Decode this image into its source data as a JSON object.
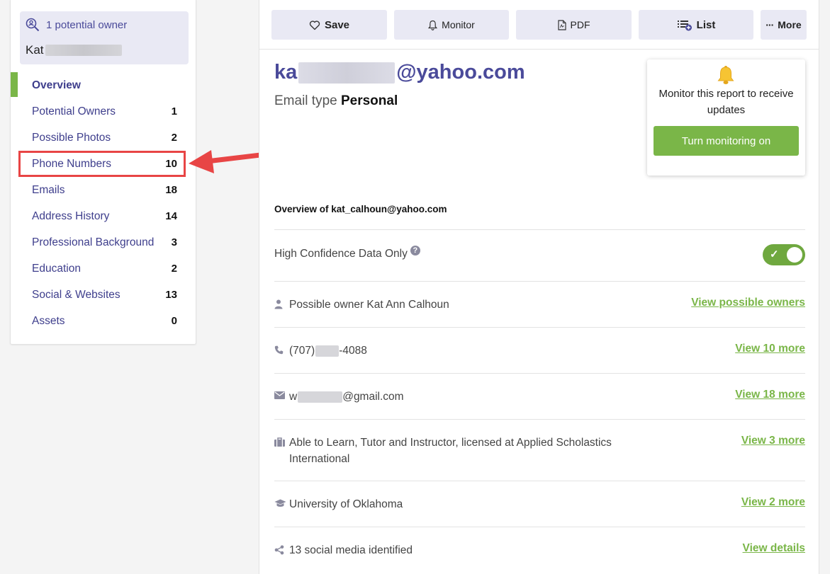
{
  "sidebar": {
    "owner_count": "1 potential owner",
    "owner_name": "Kat",
    "items": [
      {
        "label": "Overview",
        "count": ""
      },
      {
        "label": "Potential Owners",
        "count": "1"
      },
      {
        "label": "Possible Photos",
        "count": "2"
      },
      {
        "label": "Phone Numbers",
        "count": "10"
      },
      {
        "label": "Emails",
        "count": "18"
      },
      {
        "label": "Address History",
        "count": "14"
      },
      {
        "label": "Professional Background",
        "count": "3"
      },
      {
        "label": "Education",
        "count": "2"
      },
      {
        "label": "Social & Websites",
        "count": "13"
      },
      {
        "label": "Assets",
        "count": "0"
      }
    ]
  },
  "toolbar": {
    "save": "Save",
    "monitor": "Monitor",
    "pdf": "PDF",
    "list": "List",
    "more": "More"
  },
  "report": {
    "email_prefix": "ka",
    "email_domain": "@yahoo.com",
    "email_type_label": "Email type",
    "email_type_value": "Personal",
    "overview_heading": "Overview of kat_calhoun@yahoo.com"
  },
  "monitor_card": {
    "message": "Monitor this report to receive updates",
    "button": "Turn monitoring on"
  },
  "rows": {
    "confidence": {
      "label": "High Confidence Data Only",
      "help": "?",
      "toggle_on": true,
      "check": "✓"
    },
    "owner": {
      "label": "Possible owner Kat Ann Calhoun",
      "link": "View possible owners"
    },
    "phone": {
      "prefix": "(707)",
      "suffix": "-4088",
      "link": "View 10 more"
    },
    "email": {
      "prefix": "w",
      "suffix": "@gmail.com",
      "link": "View 18 more"
    },
    "job": {
      "label": "Able to Learn, Tutor and Instructor, licensed at Applied Scholastics International",
      "link": "View 3 more"
    },
    "education": {
      "label": "University of Oklahoma",
      "link": "View 2 more"
    },
    "social": {
      "label": "13 social media identified",
      "link": "View details"
    }
  },
  "colors": {
    "accent_green": "#7ab648",
    "brand_purple": "#4a4a9a",
    "highlight_red": "#e84545"
  }
}
